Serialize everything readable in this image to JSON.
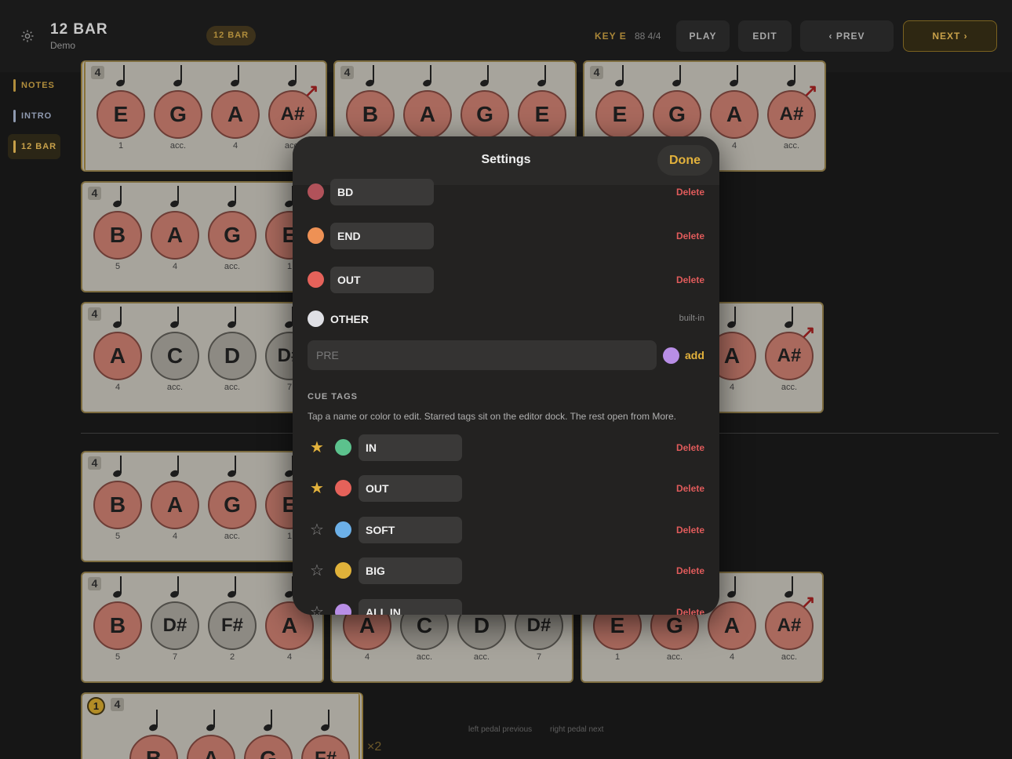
{
  "header": {
    "title": "12 BAR",
    "subtitle": "Demo",
    "tag": "12 BAR",
    "key": "KEY E",
    "tempo": "88 4/4",
    "buttons": {
      "play": "PLAY",
      "edit": "EDIT",
      "prev": "‹  PREV",
      "next": "NEXT  ›"
    }
  },
  "nav": [
    {
      "label": "NOTES",
      "color": "#b08d3c"
    },
    {
      "label": "INTRO",
      "color": "#8f9ab0"
    },
    {
      "label": "12 BAR",
      "color": "#c8a14a"
    }
  ],
  "measures": {
    "r1": [
      {
        "ts": "4",
        "notes": [
          "E",
          "G",
          "A",
          "A#"
        ],
        "labels": [
          "1",
          "acc.",
          "4",
          "acc."
        ]
      },
      {
        "ts": "4",
        "notes": [
          "B",
          "A",
          "G",
          "E"
        ],
        "labels": [
          "",
          "",
          "",
          ""
        ]
      },
      {
        "ts": "4",
        "notes": [
          "E",
          "G",
          "A",
          "A#"
        ],
        "labels": [
          "",
          "",
          "4",
          "acc."
        ]
      }
    ],
    "r2": [
      {
        "ts": "4",
        "notes": [
          "B",
          "A",
          "G",
          "E"
        ],
        "labels": [
          "5",
          "4",
          "acc.",
          "1"
        ]
      }
    ],
    "r3": [
      {
        "ts": "4",
        "notes": [
          "A",
          "C",
          "D",
          "D#"
        ],
        "labels": [
          "4",
          "acc.",
          "acc.",
          "7"
        ]
      },
      {
        "notes": [
          "A",
          "A#"
        ],
        "labels": [
          "4",
          "acc."
        ]
      }
    ],
    "r4": [
      {
        "ts": "4",
        "notes": [
          "B",
          "A",
          "G",
          "E"
        ],
        "labels": [
          "5",
          "4",
          "acc.",
          "1"
        ]
      }
    ],
    "r5": [
      {
        "ts": "4",
        "notes": [
          "B",
          "D#",
          "F#",
          "A"
        ],
        "labels": [
          "5",
          "7",
          "2",
          "4"
        ]
      },
      {
        "notes": [
          "A",
          "C",
          "D",
          "D#"
        ],
        "labels": [
          "4",
          "acc.",
          "acc.",
          "7"
        ]
      },
      {
        "notes": [
          "E",
          "G",
          "A",
          "A#"
        ],
        "labels": [
          "1",
          "acc.",
          "4",
          "acc."
        ]
      }
    ],
    "r6": [
      {
        "rep": "1",
        "ts": "4",
        "notes": [
          "B",
          "A",
          "G",
          "F#"
        ]
      }
    ],
    "repeat": "×2"
  },
  "hints": {
    "left": "left pedal previous",
    "right": "right pedal next"
  },
  "settings": {
    "title": "Settings",
    "done": "Done",
    "delete": "Delete",
    "section_tags": [
      {
        "name": "BD",
        "color": "#b1525a"
      },
      {
        "name": "END",
        "color": "#ee9155"
      },
      {
        "name": "OUT",
        "color": "#e5625a"
      }
    ],
    "other": {
      "name": "OTHER",
      "color": "#dfe0e5",
      "note": "built-in"
    },
    "new_tag": {
      "value": "PRE",
      "color": "#b88ee6",
      "add": "add"
    },
    "cue_title": "CUE TAGS",
    "cue_desc": "Tap a name or color to edit. Starred tags sit on the editor dock. The rest open from More.",
    "cue_tags": [
      {
        "name": "IN",
        "color": "#5cc28d",
        "starred": true
      },
      {
        "name": "OUT",
        "color": "#e5625a",
        "starred": true
      },
      {
        "name": "SOFT",
        "color": "#6cb0e8",
        "starred": false
      },
      {
        "name": "BIG",
        "color": "#e0b23a",
        "starred": false
      },
      {
        "name": "ALL IN",
        "color": "#b88ee6",
        "starred": false
      }
    ]
  }
}
